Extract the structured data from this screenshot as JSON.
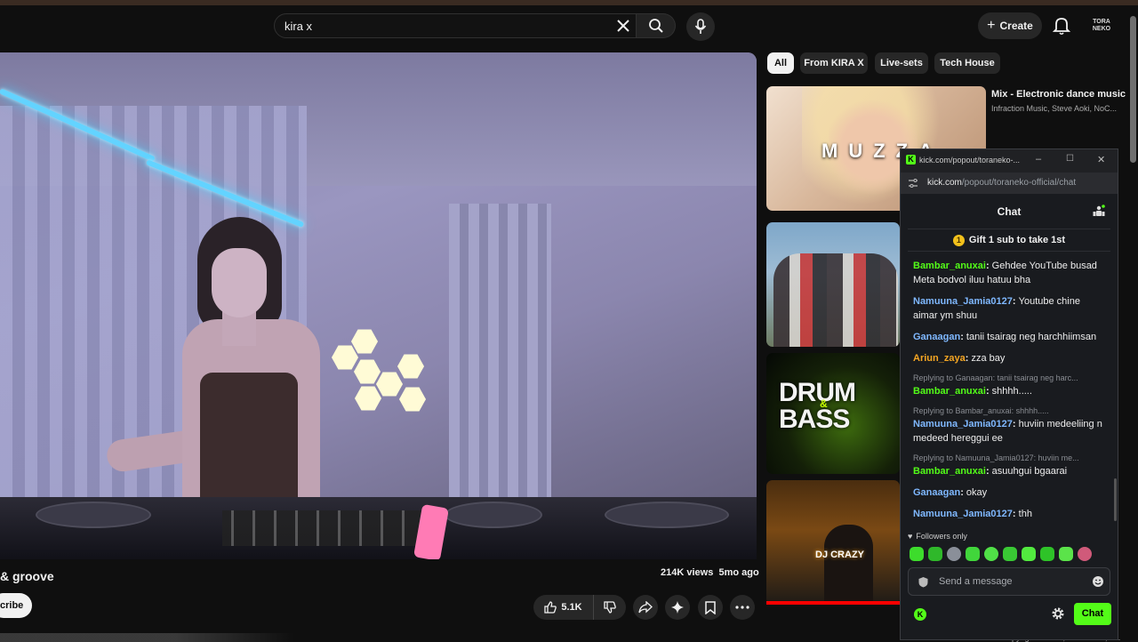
{
  "header": {
    "search_value": "kira x",
    "create_label": "Create",
    "avatar_text": "TORA NEKO"
  },
  "video": {
    "title": "& groove",
    "views": "214K views",
    "age": "5mo ago",
    "subscribe_label": "cribe",
    "like_count": "5.1K"
  },
  "chips": [
    "All",
    "From KIRA X",
    "Live-sets",
    "Tech House"
  ],
  "recommendations": [
    {
      "title": "Mix - Electronic dance music",
      "subtitle": "Infraction Music, Steve Aoki, NoC...",
      "thumb_text": "MUZZA"
    },
    {
      "thumb_text_1": "DRUM",
      "thumb_text_2": "&",
      "thumb_text_3": "BASS"
    },
    {
      "thumb_text": "DJ CRAZY"
    }
  ],
  "rec_bottom": "NoCopyrightSounds, JONTARO, P...",
  "kick": {
    "tab_title": "kick.com/popout/toraneko-...",
    "url_host": "kick.com",
    "url_path": "/popout/toraneko-official/chat",
    "chat_title": "Chat",
    "gift_text": "Gift 1 sub to take 1st",
    "messages": [
      {
        "user": "Bambar_anuxai",
        "color": "#53fc18",
        "text": "Gehdee YouTube busad Meta bodvol iluu hatuu bha"
      },
      {
        "user": "Namuuna_Jamia0127",
        "color": "#7fb8ff",
        "text": "Youtube chine aimar ym shuu"
      },
      {
        "user": "Ganaagan",
        "color": "#7fb8ff",
        "text": "tanii tsairag neg harchhiimsan"
      },
      {
        "user": "Ariun_zaya",
        "color": "#f5a623",
        "text": "zza bay"
      },
      {
        "reply": "Replying to Ganaagan: tanii tsairag neg harc...",
        "user": "Bambar_anuxai",
        "color": "#53fc18",
        "text": "shhhh....."
      },
      {
        "reply": "Replying to Bambar_anuxai: shhhh.....",
        "user": "Namuuna_Jamia0127",
        "color": "#7fb8ff",
        "text": "huviin medeeliing n medeed hereggui ee"
      },
      {
        "reply": "Replying to Namuuna_Jamia0127: huviin me...",
        "user": "Bambar_anuxai",
        "color": "#53fc18",
        "text": "asuuhgui bgaarai"
      },
      {
        "user": "Ganaagan",
        "color": "#7fb8ff",
        "text": "okay"
      },
      {
        "user": "Namuuna_Jamia0127",
        "color": "#7fb8ff",
        "text": "thh"
      }
    ],
    "followers_label": "Followers only",
    "input_placeholder": "Send a message",
    "chat_button": "Chat",
    "accent": "#53fc18"
  }
}
